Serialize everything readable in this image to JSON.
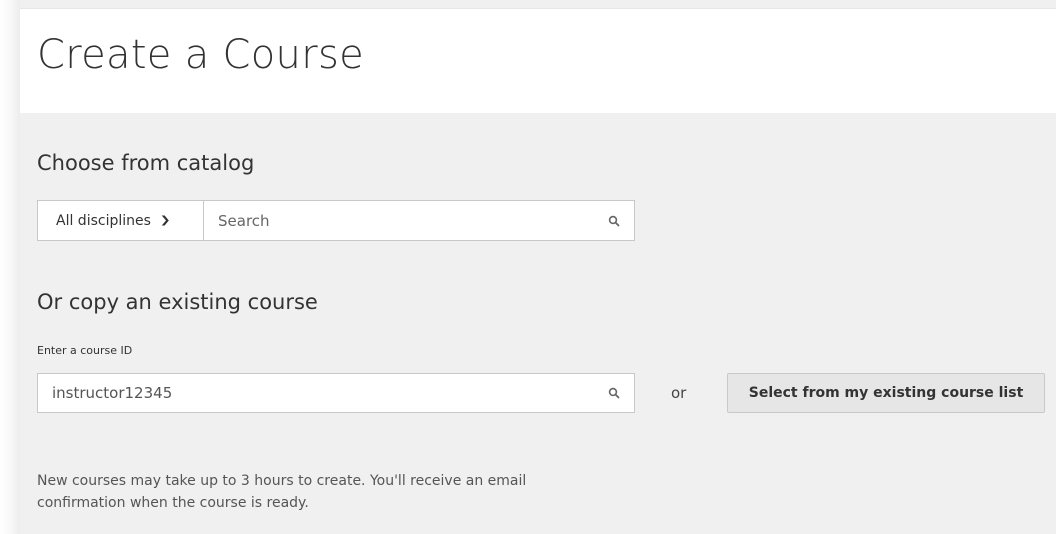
{
  "header": {
    "title": "Create a Course"
  },
  "catalog": {
    "heading": "Choose from catalog",
    "discipline_select": {
      "selected": "All disciplines"
    },
    "search": {
      "placeholder": "Search",
      "icon": "search-icon"
    }
  },
  "copy": {
    "heading": "Or copy an existing course",
    "course_id_label": "Enter a course ID",
    "course_id_value": "instructor12345",
    "or_text": "or",
    "select_list_button": "Select from my existing course list"
  },
  "note": "New courses may take up to 3 hours to create. You'll receive an email confirmation when the course is ready.",
  "colors": {
    "page_bg": "#f0f0f0",
    "header_bg": "#ffffff",
    "border": "#c8c8c8",
    "button_bg": "#e6e6e6"
  }
}
